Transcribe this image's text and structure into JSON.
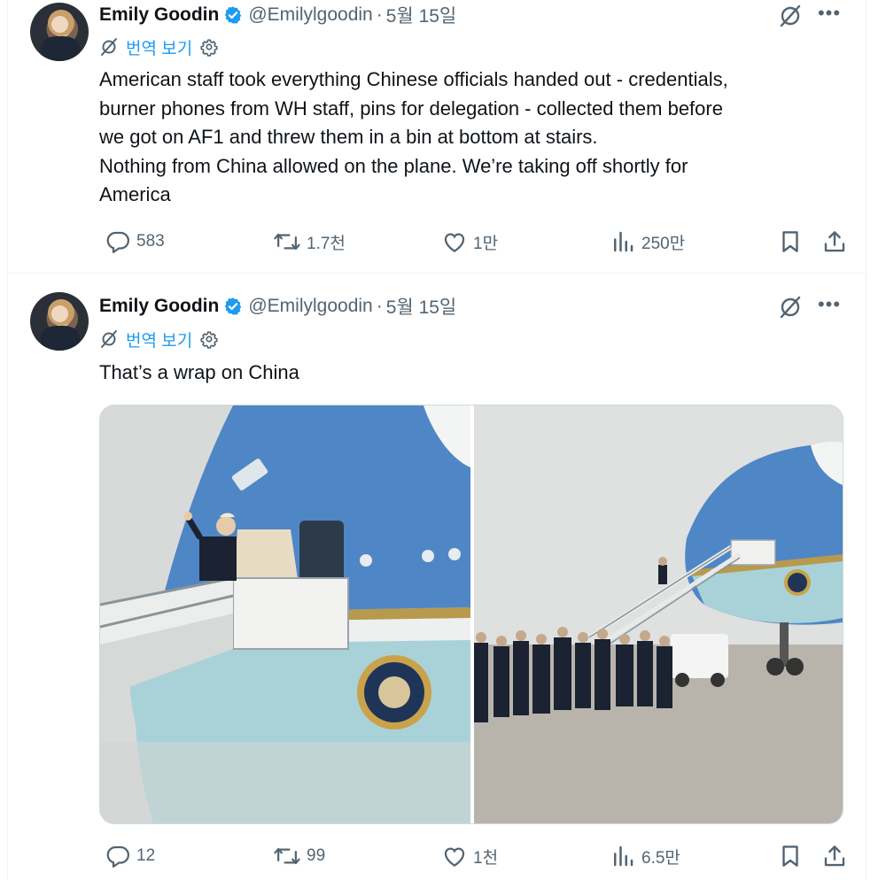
{
  "tweets": [
    {
      "author_name": "Emily Goodin",
      "handle": "@Emilylgoodin",
      "separator": "·",
      "date": "5월 15일",
      "translate_label": "번역 보기",
      "text_lines": [
        "American staff took everything Chinese officials handed out - credentials,",
        "burner phones from WH staff, pins for delegation - collected them before",
        "we got on AF1 and threw them in a bin at bottom at stairs.",
        "Nothing from China allowed on the plane. We’re taking off shortly for",
        "America"
      ],
      "replies": "583",
      "reposts": "1.7천",
      "likes": "1만",
      "views": "250만"
    },
    {
      "author_name": "Emily Goodin",
      "handle": "@Emilylgoodin",
      "separator": "·",
      "date": "5월 15일",
      "translate_label": "번역 보기",
      "text_lines": [
        "That’s a wrap on China"
      ],
      "replies": "12",
      "reposts": "99",
      "likes": "1천",
      "views": "6.5만"
    }
  ],
  "icons": {
    "verified": "verified-badge-icon",
    "grok": "grok-icon",
    "more": "more-icon",
    "translate": "translate-icon",
    "settings": "gear-icon",
    "reply": "reply-icon",
    "repost": "repost-icon",
    "like": "heart-icon",
    "views": "views-icon",
    "bookmark": "bookmark-icon",
    "share": "share-icon"
  },
  "colors": {
    "accent": "#1d9bf0",
    "secondary_text": "#536471",
    "primary_text": "#0f1419",
    "aircraft_blue": "#4f86c6",
    "aircraft_lower": "#a9d2d8"
  }
}
